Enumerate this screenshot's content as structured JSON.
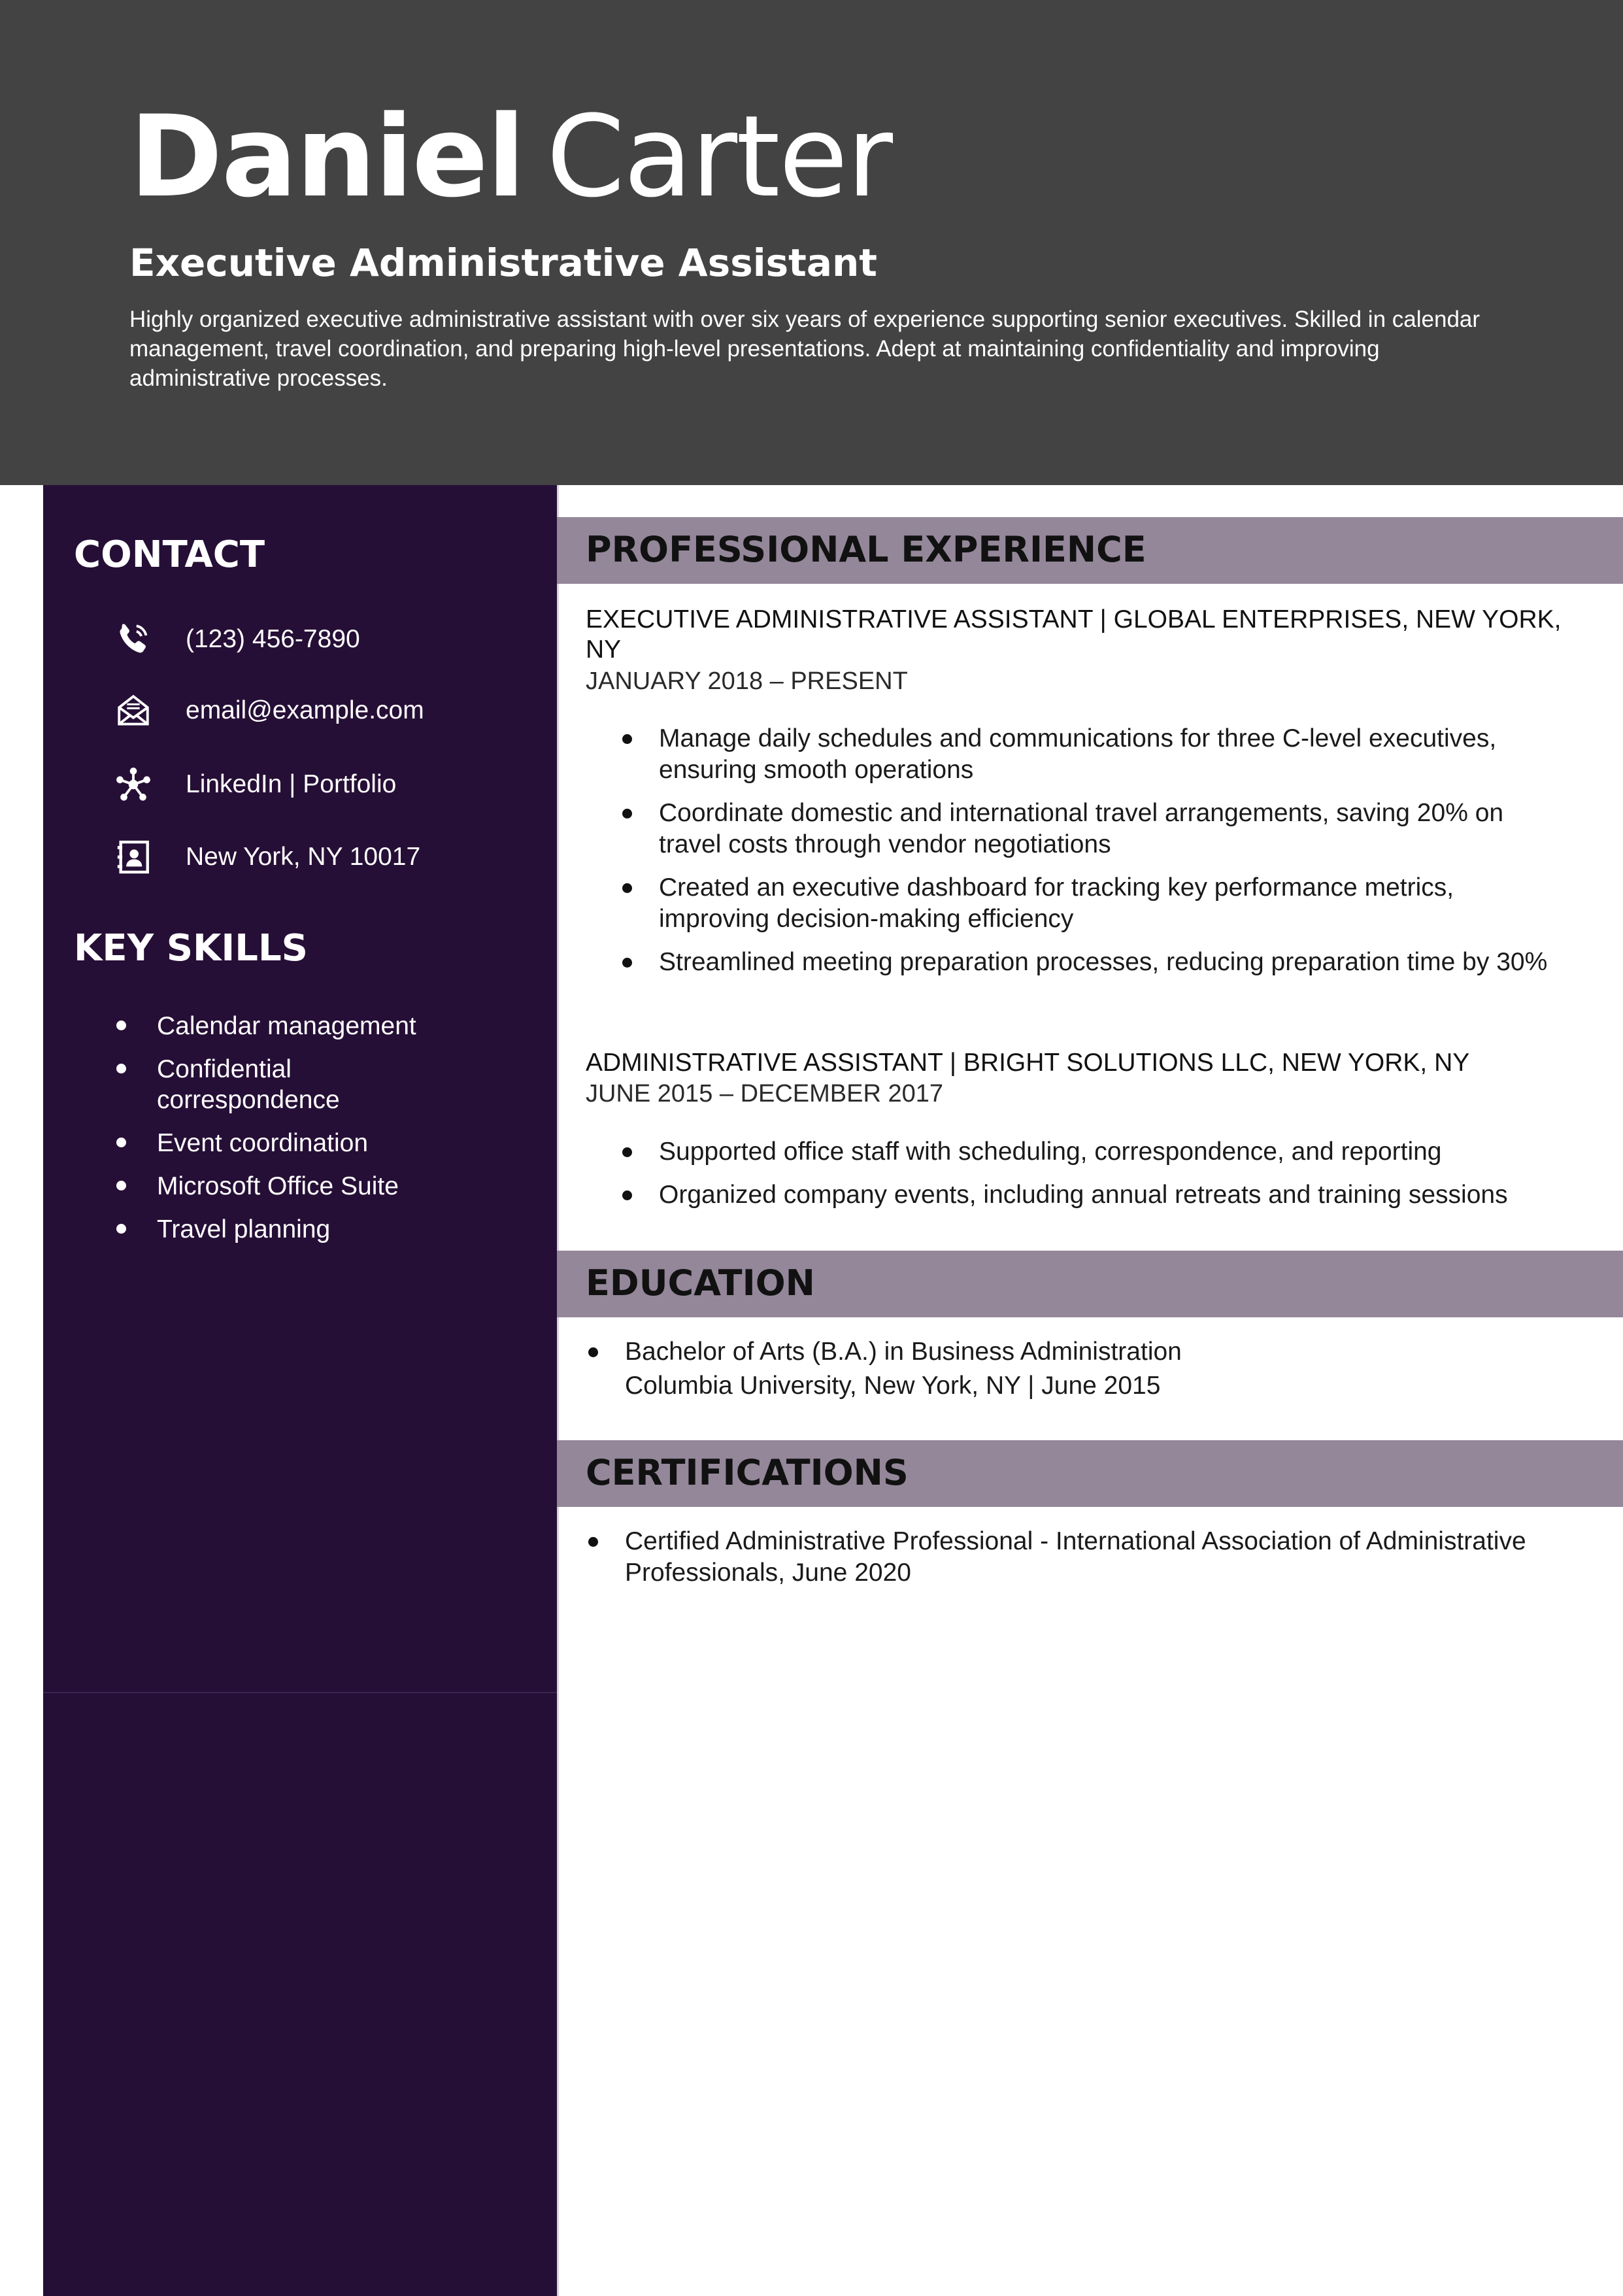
{
  "header": {
    "first_name": "Daniel",
    "last_name": "Carter",
    "title": "Executive Administrative Assistant",
    "summary": "Highly organized executive administrative assistant with over six years of experience supporting senior executives. Skilled in calendar management, travel coordination, and preparing high-level presentations. Adept at maintaining confidentiality and improving administrative processes."
  },
  "sidebar": {
    "contact_heading": "CONTACT",
    "contact": [
      {
        "icon": "phone-icon",
        "text": "(123) 456-7890"
      },
      {
        "icon": "envelope-icon",
        "text": "email@example.com"
      },
      {
        "icon": "network-icon",
        "text": "LinkedIn | Portfolio"
      },
      {
        "icon": "address-book-icon",
        "text": "New York, NY 10017"
      }
    ],
    "skills_heading": "KEY SKILLS",
    "skills": [
      "Calendar management",
      "Confidential correspondence",
      "Event coordination",
      "Microsoft Office Suite",
      "Travel planning"
    ]
  },
  "experience": {
    "heading": "PROFESSIONAL EXPERIENCE",
    "jobs": [
      {
        "title_line": "EXECUTIVE ADMINISTRATIVE ASSISTANT | GLOBAL ENTERPRISES, NEW YORK, NY",
        "dates": "JANUARY 2018 – PRESENT",
        "bullets": [
          "Manage daily schedules and communications for three C-level executives, ensuring smooth operations",
          "Coordinate domestic and international travel arrangements, saving 20% on travel costs through vendor negotiations",
          "Created an executive dashboard for tracking key performance metrics, improving decision-making efficiency",
          "Streamlined meeting preparation processes, reducing preparation time by 30%"
        ]
      },
      {
        "title_line": "ADMINISTRATIVE ASSISTANT | BRIGHT SOLUTIONS LLC, NEW YORK, NY",
        "dates": "JUNE 2015 – DECEMBER 2017",
        "bullets": [
          "Supported office staff with scheduling, correspondence, and reporting",
          "Organized company events, including annual retreats and training sessions"
        ]
      }
    ]
  },
  "education": {
    "heading": "EDUCATION",
    "degree": "Bachelor of Arts (B.A.) in Business Administration",
    "school": "Columbia University, New York, NY | June 2015"
  },
  "certifications": {
    "heading": "CERTIFICATIONS",
    "items": [
      "Certified Administrative Professional - International Association of Administrative Professionals, June 2020"
    ]
  },
  "colors": {
    "header_bg": "#434343",
    "sidebar_bg": "#260f36",
    "section_bar_bg": "#938799"
  }
}
